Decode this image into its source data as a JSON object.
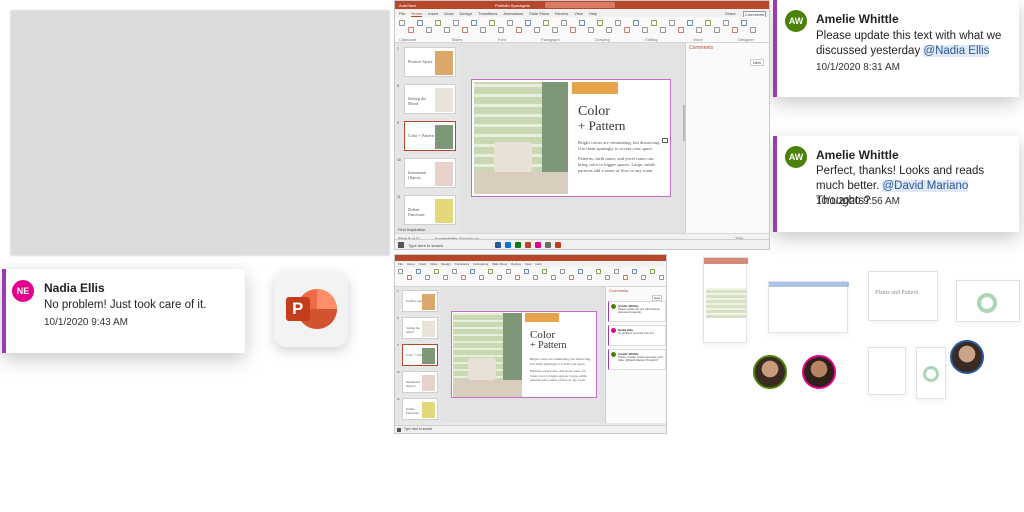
{
  "comments": [
    {
      "initials": "AW",
      "name": "Amelie Whittle",
      "text_before": "Please update this text with what we discussed yesterday ",
      "mention": "@Nadia Ellis",
      "text_after": "",
      "time": "10/1/2020 8:31 AM",
      "avatar_color": "#498205",
      "bar_color": "#9b3bb0"
    },
    {
      "initials": "AW",
      "name": "Amelie Whittle",
      "text_before": "Perfect, thanks! Looks and reads much better. ",
      "mention": "@David Mariano",
      "text_after": " Thoughts?",
      "time": "10/1/2020 9:56 AM",
      "avatar_color": "#498205",
      "bar_color": "#9b3bb0"
    },
    {
      "initials": "NE",
      "name": "Nadia Ellis",
      "text": "No problem! Just took care of it.",
      "time": "10/1/2020 9:43 AM",
      "avatar_color": "#e3008c",
      "bar_color": "#9b3bb0"
    }
  ],
  "ppt_icon": {
    "letter": "P",
    "name": "powerpoint-icon"
  },
  "window_main": {
    "title": "Portfolio Spacegate",
    "tabs": [
      "File",
      "Home",
      "Insert",
      "Draw",
      "Design",
      "Transitions",
      "Animations",
      "Slide Show",
      "Review",
      "View",
      "Help"
    ],
    "active_tab": "Home",
    "share_label": "Share",
    "comments_button": "Comments",
    "ribbon_groups": [
      "Clipboard",
      "Slides",
      "Font",
      "Paragraph",
      "Drawing",
      "Editing",
      "Voice",
      "Designer"
    ],
    "comments_pane_title": "Comments",
    "new_label": "New",
    "thumbs": [
      {
        "num": "7",
        "label": "Positive Space"
      },
      {
        "num": "8",
        "label": "Setting the Mood"
      },
      {
        "num": "9",
        "label": "Color + Pattern"
      },
      {
        "num": "10",
        "label": "Intentional Objects"
      },
      {
        "num": "11",
        "label": "Define Functions"
      }
    ],
    "status_left": "Slide 9 of 11",
    "status_mid": "Accessibility: Good to go",
    "notes_label": "Find Inspiration",
    "search_placeholder": "Type here to search",
    "zoom": "72%"
  },
  "slide": {
    "title_line1": "Color",
    "title_line2": "+ Pattern",
    "para1": "Bright colors are stimulating, but distracting. Use them sparingly to accent your space.",
    "para2": "Patterns, earth tones, and jewel tones can bring color to bigger spaces. Large, subtle patterns add a sense of flow to any room."
  },
  "window_second": {
    "comments_title": "Comments",
    "new_label": "New",
    "comments": [
      {
        "name": "Amelie Whittle",
        "text": "Please update this text with what we discussed yesterday"
      },
      {
        "name": "Nadia Ellis",
        "text": "No problem! Just took care of it."
      },
      {
        "name": "Amelie Whittle",
        "text": "Perfect, thanks! Looks and reads much better. @David Mariano Thoughts?"
      }
    ]
  },
  "mini_windows": {
    "plants_title": "Plants and Pattern"
  }
}
